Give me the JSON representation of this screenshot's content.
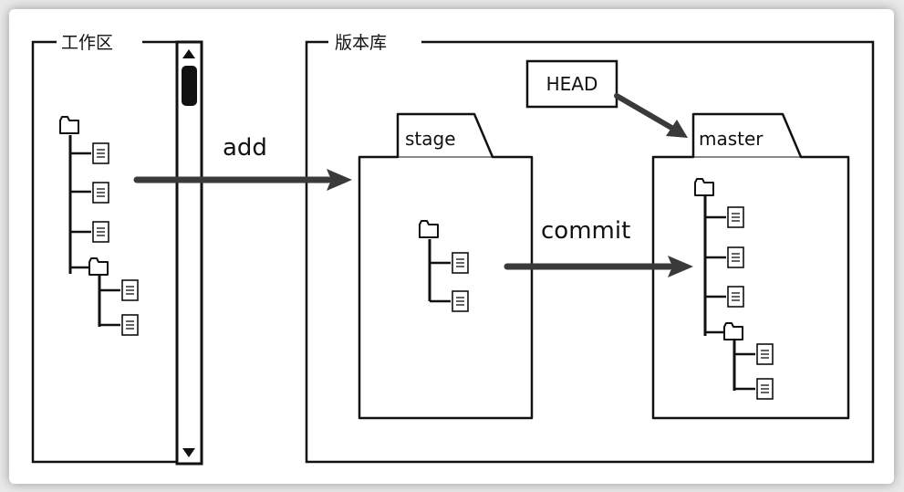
{
  "workspace": {
    "title": "工作区"
  },
  "repository": {
    "title": "版本库"
  },
  "stage": {
    "label": "stage"
  },
  "master": {
    "label": "master"
  },
  "head": {
    "label": "HEAD"
  },
  "arrows": {
    "add": "add",
    "commit": "commit"
  },
  "icons": {
    "folder": "folder-icon",
    "file": "file-icon",
    "scroll_up": "scroll-up-arrow-icon",
    "scroll_down": "scroll-down-arrow-icon"
  },
  "colors": {
    "line": "#111111",
    "arrow": "#3a3a3a",
    "background": "#ffffff"
  }
}
